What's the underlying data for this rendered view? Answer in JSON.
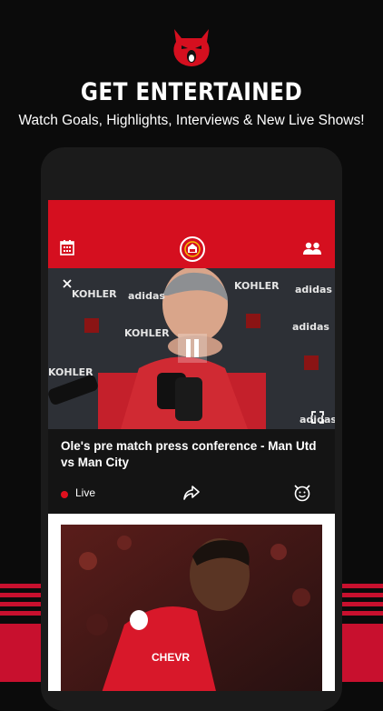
{
  "promo": {
    "headline": "GET ENTERTAINED",
    "subline": "Watch Goals, Highlights, Interviews & New Live Shows!"
  },
  "app": {
    "header": {
      "left_icon": "calendar-icon",
      "center_icon": "club-crest-icon",
      "right_icon": "users-icon"
    },
    "video": {
      "sponsor_texts": [
        "KOHLER",
        "adidas",
        "KOHLER",
        "adidas",
        "KOHLER",
        "adidas",
        "KOHLER",
        "adidas"
      ],
      "controls": [
        "close-icon",
        "pause-icon",
        "fullscreen-icon"
      ]
    },
    "card": {
      "title": "Ole's pre match press conference - Man Utd vs Man City",
      "status_label": "Live",
      "status_color": "#e0101e",
      "actions": [
        "share-icon",
        "devil-emoji-icon"
      ]
    }
  },
  "colors": {
    "brand_red": "#d50f1f",
    "background": "#0b0b0b"
  }
}
